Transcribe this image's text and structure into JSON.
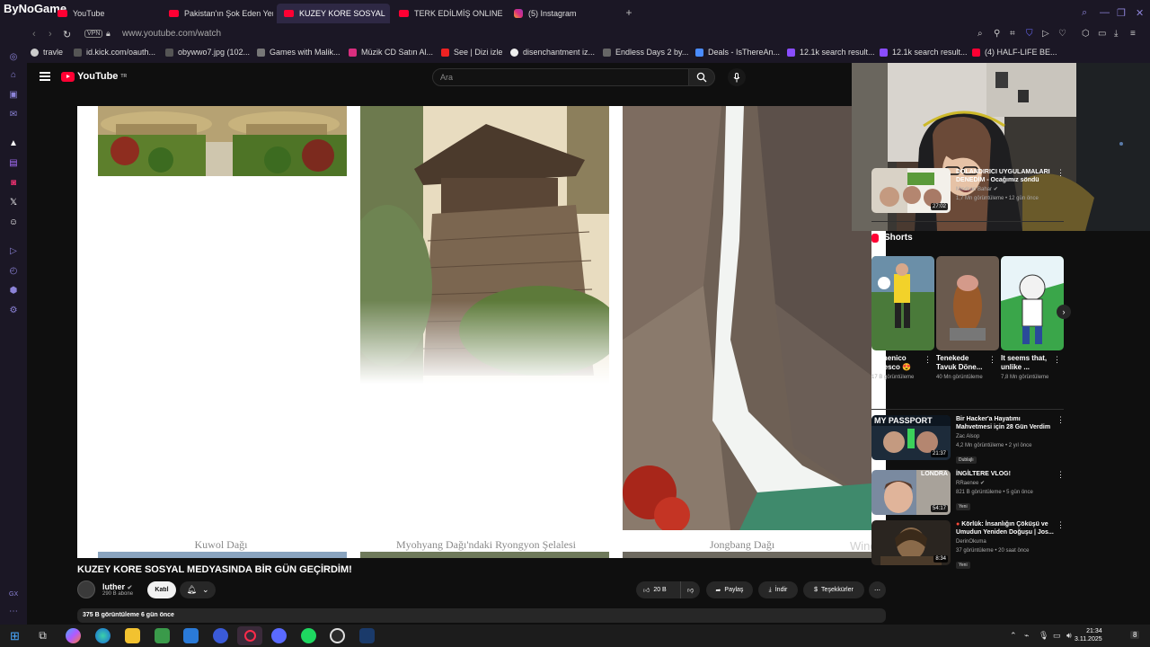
{
  "browser": {
    "brand": "ByNoGame",
    "tabs": [
      {
        "label": "YouTube",
        "icon": "youtube-icon",
        "active": false
      },
      {
        "label": "Pakistan'ın Şok Eden Yen",
        "icon": "youtube-icon",
        "active": false
      },
      {
        "label": "KUZEY KORE SOSYAL",
        "icon": "youtube-icon",
        "active": true
      },
      {
        "label": "TERK EDİLMİŞ ONLINE O",
        "icon": "youtube-icon",
        "active": false
      },
      {
        "label": "(5) Instagram",
        "icon": "instagram-icon",
        "active": false
      }
    ],
    "vpn": "VPN",
    "url": "www.youtube.com/watch",
    "bookmarks": [
      "travle",
      "id.kick.com/oauth...",
      "obywwo7.jpg (102...",
      "Games with Malik...",
      "Müzik CD Satın Al...",
      "See | Dizi izle",
      "disenchantment iz...",
      "Endless Days 2 by...",
      "Deals - IsThereAn...",
      "12.1k search result...",
      "12.1k search result...",
      "(4) HALF-LIFE BE..."
    ],
    "sidebar_label": "GX"
  },
  "youtube": {
    "logo": "YouTube",
    "logo_sup": "TR",
    "search_placeholder": "Ara",
    "video": {
      "captions": [
        "Kuwol Dağı",
        "Myohyang Dağı'ndaki Ryongyon Şelalesi",
        "Jongbang Dağı"
      ],
      "watermark": "Windo",
      "title": "KUZEY KORE SOSYAL MEDYASINDA BİR GÜN GEÇİRDİM!",
      "channel": "luther",
      "subscribers": "290 B abone",
      "join": "Katıl",
      "likes": "20 B",
      "share": "Paylaş",
      "download": "İndir",
      "thanks": "Teşekkürler",
      "views_line": "375 B görüntüleme  6 gün önce"
    },
    "rail": {
      "top_card": {
        "title": "DOLANDIRICI UYGULAMALARI DENEDİM - Ocağımız söndü",
        "channel": "Mevlcan Bahar",
        "meta": "1,7 Mn görüntüleme • 12 gün önce",
        "duration": "27:02"
      },
      "shorts_heading": "Shorts",
      "shorts": [
        {
          "title": "Domenico Tedesco 😍",
          "meta": "17 B görüntüleme"
        },
        {
          "title": "Tenekede Tavuk Döne...",
          "meta": "40 Mn görüntüleme"
        },
        {
          "title": "It seems that, unlike ...",
          "meta": "7,8 Mn görüntüleme"
        }
      ],
      "videos": [
        {
          "title": "Bir Hacker'a Hayatımı Mahvetmesi için 28 Gün Verdim",
          "channel": "Zac Alsop",
          "meta": "4,2 Mn görüntüleme • 2 yıl önce",
          "duration": "21:37",
          "badge": "Dublajlı"
        },
        {
          "title": "İNGİLTERE VLOG!",
          "channel": "RRaenee",
          "meta": "821 B görüntüleme • 5 gün önce",
          "duration": "54:17",
          "badge": "Yeni"
        },
        {
          "title": "Körlük: İnsanlığın Çöküşü ve Umudun Yeniden Doğuşu | Jos...",
          "channel": "DerinOkuma",
          "meta": "37 görüntüleme • 20 saat önce",
          "duration": "8:34",
          "badge": "Yeni"
        }
      ]
    }
  },
  "taskbar": {
    "time": "21:34",
    "date": "3.11.2025",
    "notif": "8"
  }
}
